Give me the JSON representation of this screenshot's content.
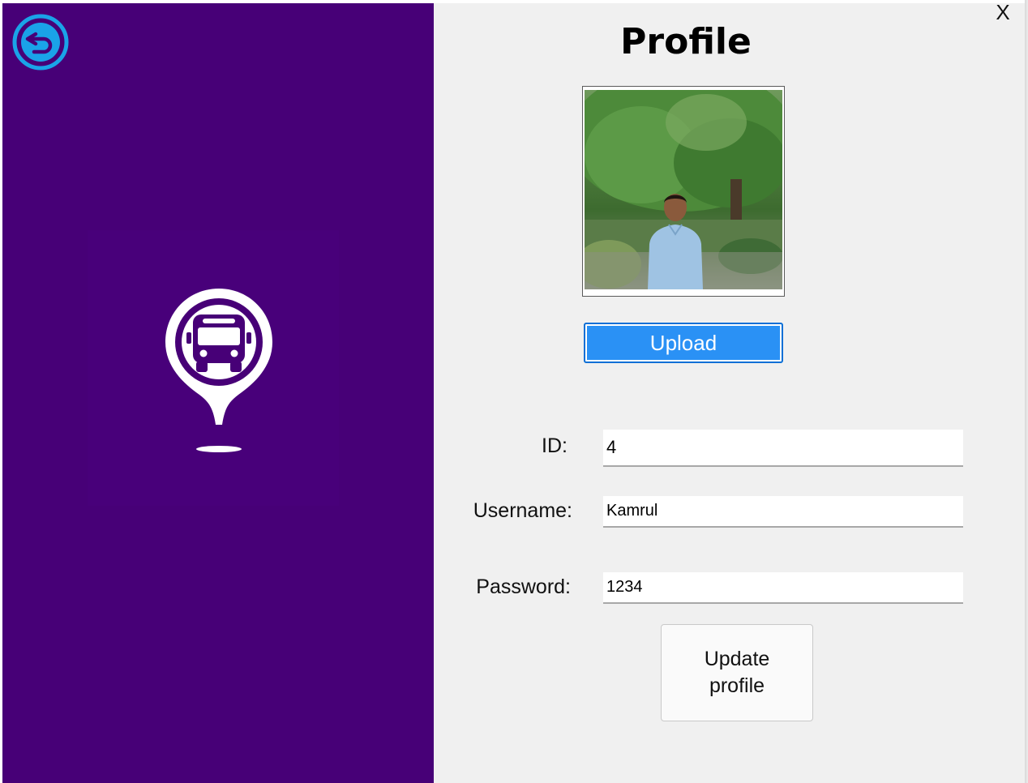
{
  "window": {
    "close_label": "X"
  },
  "sidebar": {
    "background_color": "#470077",
    "back_icon": "back-arrow-circle-icon",
    "logo_icon": "bus-location-pin-icon"
  },
  "profile": {
    "title": "Profile",
    "photo": "profile-photo",
    "upload_label": "Upload",
    "fields": {
      "id_label": "ID:",
      "id_value": "4",
      "username_label": "Username:",
      "username_value": "Kamrul",
      "password_label": "Password:",
      "password_value": "1234"
    },
    "update_label_line1": "Update",
    "update_label_line2": "profile"
  },
  "colors": {
    "accent": "#2a91f5",
    "back_icon": "#1aa3e8"
  }
}
